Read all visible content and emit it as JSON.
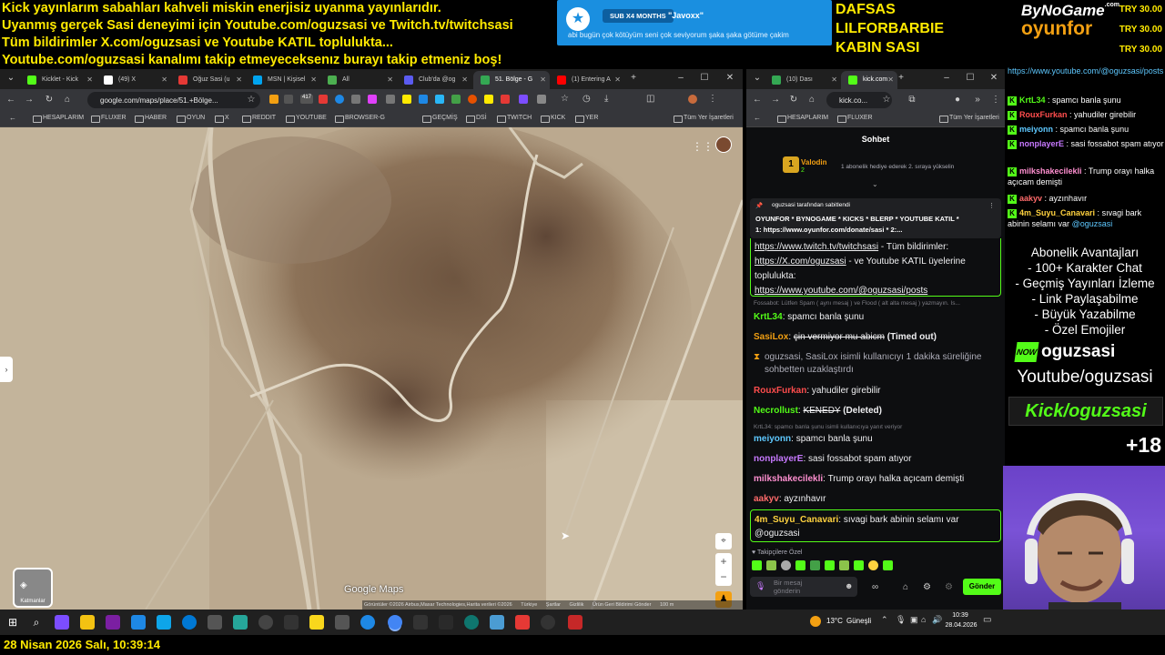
{
  "banner": {
    "lines": [
      "Kick yayınlarım sabahları kahveli miskin enerjisiz uyanma yayınlarıdır.",
      "Uyanmış gerçek Sasi deneyimi için Youtube.com/oguzsasi ve Twitch.tv/twitchsasi",
      "Tüm bildirimler X.com/oguzsasi ve Youtube KATIL toplulukta...",
      "Youtube.com/oguzsasi kanalımı takip etmeyeceksenız burayı takip etmeniz boş!"
    ]
  },
  "sub_alert": {
    "badge": "SUB X4 MONTHS",
    "user": "\"Javoxx\"",
    "message": "abi bugün çok kötüyüm seni çok seviyorum şaka şaka götüme çakim"
  },
  "names": [
    "DAFSAS",
    "LILFORBARBIE",
    "KABIN SASI"
  ],
  "logo": {
    "line1": "ByNoGame",
    "line1_sup": ".com",
    "line2": "oyunfor"
  },
  "tries": [
    "TRY 30.00",
    "TRY 30.00",
    "TRY 30.00"
  ],
  "browser_left": {
    "tabs": [
      {
        "label": "Kicklet - Kick",
        "color": "#53fc18"
      },
      {
        "label": "(49) X",
        "color": "#ffffff"
      },
      {
        "label": "Oğuz Sasi (u",
        "color": "#e53935"
      },
      {
        "label": "MSN | Kişisel",
        "color": "#00a4ef"
      },
      {
        "label": "All",
        "color": "#4caf50"
      },
      {
        "label": "Club'da @og",
        "color": "#5b5bf0"
      },
      {
        "label": "51. Bölge - G",
        "color": "#34a853"
      },
      {
        "label": "(1) Entering A",
        "color": "#ff0000"
      }
    ],
    "url": "google.com/maps/place/51.+Bölge...",
    "bookmarks": [
      "HESAPLARIM",
      "FLUXER",
      "HABER",
      "OYUN",
      "X",
      "REDDIT",
      "YOUTUBE",
      "BROWSER-G",
      "GEÇMİŞ",
      "DSİ",
      "TWITCH",
      "KICK",
      "YER"
    ],
    "all_bookmarks": "Tüm Yer İşaretleri",
    "map": {
      "layers_label": "Katmanlar",
      "watermark": "Google Maps",
      "attribution": "Görüntüler ©2026 Airbus,Maxar Technologies,Harita verileri ©2026",
      "footer_links": [
        "Türkiye",
        "Şartlar",
        "Gizlilik",
        "Ürün Geri Bildirimi Gönder"
      ],
      "scale": "100 m"
    }
  },
  "browser_right": {
    "tabs": [
      {
        "label": "(10) Dası",
        "color": "#34a853"
      },
      {
        "label": "kick.com",
        "color": "#53fc18"
      }
    ],
    "url": "kick.co...",
    "bookmarks": [
      "HESAPLARIM",
      "FLUXER"
    ],
    "all_bookmarks": "Tüm Yer İşaretleri",
    "chat_title": "Sohbet",
    "gift": {
      "rank": "1",
      "user": "Valodin",
      "count": "2",
      "text": "1 abonelik hediye ederek 2. sıraya yükselin"
    },
    "pinned": {
      "by": "oguzsasi tarafından sabitlendi",
      "text": "OYUNFOR * BYNOGAME * KICKS * BLERP * YOUTUBE KATIL *",
      "link_line": "1: https://www.oyunfor.com/donate/sasi * 2:..."
    },
    "pinned_box": {
      "line1": "https://www.twitch.tv/twitchsasi",
      "line1b": " - Tüm bildirimler: ",
      "line2": "https://X.com/oguzsasi",
      "line2b": " - ve Youtube KATIL üyelerine topluluktа:",
      "line3": "https://www.youtube.com/@oguzsasi/posts"
    },
    "mod_note": "Fossabot: Lütfen Spam ( aynı mesaj ) ve Flood ( alt alta mesaj ) yazmayın. Is...",
    "messages": [
      {
        "user": "KrtL34",
        "color": "#53fc18",
        "text": "spamcı banla şunu"
      },
      {
        "user": "SasiLox",
        "color": "#f3a012",
        "text": "çin vermiyor mu abicm",
        "suffix": "(Timed out)"
      },
      {
        "system": "oguzsasi, SasiLox isimli kullanıcıyı 1 dakika süreliğine sohbetten uzaklaştırdı"
      },
      {
        "user": "RouxFurkan",
        "color": "#ff4d4d",
        "text": "yahudiler girebilir"
      },
      {
        "user": "Necrollust",
        "color": "#53fc18",
        "text": "KENEDY",
        "suffix": "(Deleted)"
      },
      {
        "reply": "KrtL34: spamcı banla şunu isimli kullanıcıya yanıt veriyor"
      },
      {
        "user": "meiyonn",
        "color": "#5ec8ff",
        "text": "spamcı banla şunu"
      },
      {
        "user": "nonplayerE",
        "color": "#c779ff",
        "text": "sasi fossabot spam atıyor"
      },
      {
        "user": "milkshakecilekli",
        "color": "#ff8fd0",
        "text": "Trump orayı halka açıcam demişti"
      },
      {
        "user": "aakyv",
        "color": "#ff6b6b",
        "text": "ayzınhavır"
      },
      {
        "user": "4m_Suyu_Canavari",
        "color": "#ffd23f",
        "text": "sıvagi bark abinin selamı var @oguzsasi"
      }
    ],
    "followers_only": "Takipçilere Özel",
    "input_placeholder": "Bir mesaj gönderin",
    "send": "Gönder"
  },
  "right_panel": {
    "top_link": "https://www.youtube.com/@oguzsasi/posts",
    "messages": [
      {
        "user": "KrtL34",
        "color": "#53fc18",
        "text": "spamcı banla şunu"
      },
      {
        "user": "RouxFurkan",
        "color": "#ff4d4d",
        "text": "yahudiler girebilir"
      },
      {
        "user": "meiyonn",
        "color": "#5ec8ff",
        "text": "spamcı banla şunu"
      },
      {
        "user": "nonplayerE",
        "color": "#c779ff",
        "text": "sasi fossabot spam atıyor"
      },
      {
        "user": "milkshakecilekli",
        "color": "#ff8fd0",
        "text": "Trump orayı halka açıcam demişti"
      },
      {
        "user": "aakyv",
        "color": "#ff6b6b",
        "text": "ayzınhavır"
      },
      {
        "user": "4m_Suyu_Canavari",
        "color": "#ffd23f",
        "text": "sıvagi bark abinin selamı var",
        "mention": "@oguzsasi"
      }
    ],
    "perks_title": "Abonelik Avantajları",
    "perks": [
      "- 100+ Karakter Chat",
      "- Geçmiş Yayınları İzleme",
      "- Link Paylaşabilme",
      "- Büyük Yazabilme",
      "- Özel Emojiler"
    ],
    "now_badge": "NOW",
    "now_user": "oguzsasi",
    "youtube": "Youtube/oguzsasi",
    "kick": "Kick/oguzsasi",
    "age": "+18"
  },
  "taskbar": {
    "weather": "13°C",
    "weather_text": "Güneşli",
    "time": "10:39",
    "date": "28.04.2026"
  },
  "footer": "28 Nisan 2026 Salı, 10:39:14"
}
